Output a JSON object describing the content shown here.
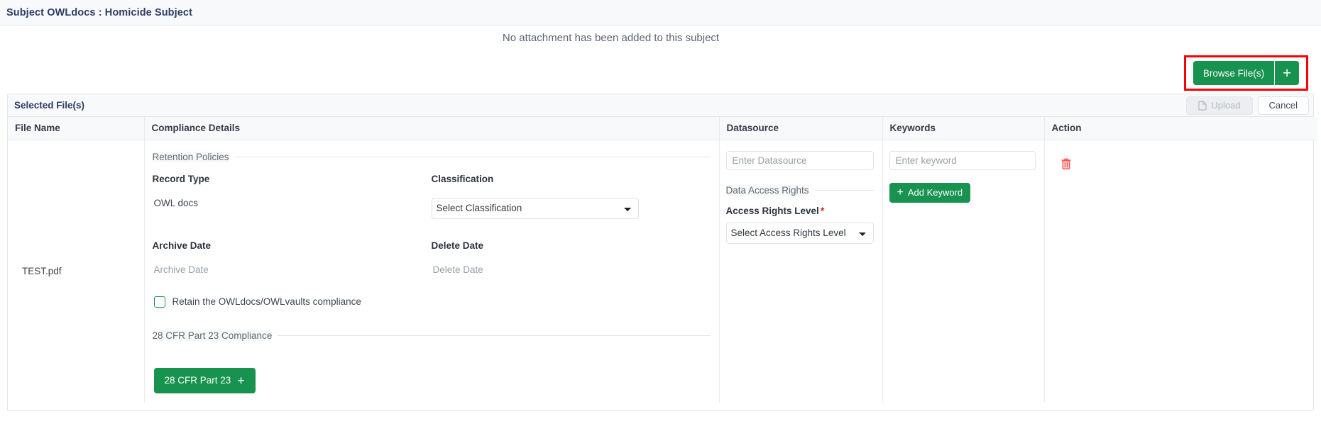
{
  "subject": {
    "title": "Subject OWLdocs : Homicide Subject"
  },
  "attachment_notice": "No attachment has been added to this subject",
  "browse": {
    "label": "Browse File(s)",
    "plus_icon": "plus-icon",
    "highlight_color": "#ff0000",
    "accent_color": "#17924f"
  },
  "selected_files_panel": {
    "title": "Selected File(s)",
    "upload_label": "Upload",
    "upload_icon": "file-icon",
    "upload_disabled": true,
    "cancel_label": "Cancel"
  },
  "table": {
    "headers": {
      "file_name": "File Name",
      "compliance_details": "Compliance Details",
      "datasource": "Datasource",
      "keywords": "Keywords",
      "action": "Action"
    },
    "row": {
      "file_name": "TEST.pdf",
      "compliance": {
        "retention_legend": "Retention Policies",
        "record_type_label": "Record Type",
        "record_type_value": "OWL docs",
        "classification_label": "Classification",
        "classification_selected": "Select Classification",
        "classification_options": [
          "Select Classification"
        ],
        "archive_date_label": "Archive Date",
        "archive_date_placeholder": "Archive Date",
        "delete_date_label": "Delete Date",
        "delete_date_placeholder": "Delete Date",
        "retain_checkbox_label": "Retain the OWLdocs/OWLvaults compliance",
        "retain_checked": false,
        "cfr_legend": "28 CFR Part 23 Compliance",
        "cfr_button_label": "28 CFR Part 23",
        "cfr_button_icon": "plus-icon"
      },
      "datasource": {
        "input_placeholder": "Enter Datasource",
        "input_value": "",
        "data_access_legend": "Data Access Rights",
        "access_rights_label": "Access Rights Level",
        "access_rights_required": "*",
        "access_rights_selected": "Select Access Rights Level",
        "access_rights_options": [
          "Select Access Rights Level"
        ]
      },
      "keywords": {
        "input_placeholder": "Enter keyword",
        "input_value": "",
        "add_button_label": "Add Keyword",
        "add_button_icon": "plus-icon"
      },
      "action": {
        "delete_icon": "trash-icon",
        "delete_color": "#fa5252"
      }
    }
  }
}
